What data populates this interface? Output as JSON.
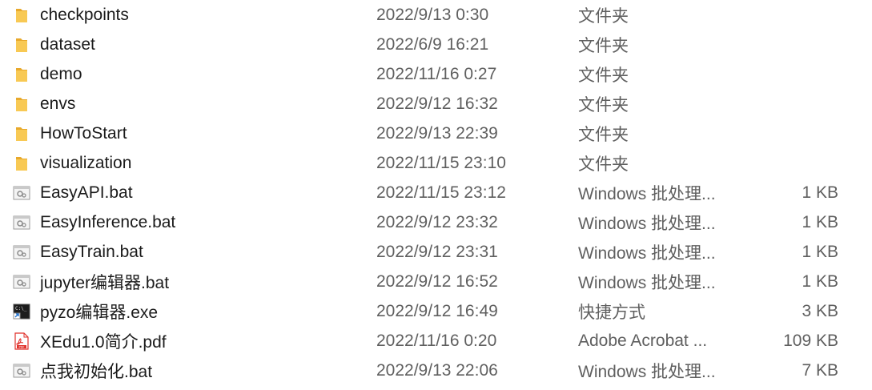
{
  "files": [
    {
      "name": "checkpoints",
      "date": "2022/9/13 0:30",
      "type": "文件夹",
      "size": "",
      "icon": "folder-icon"
    },
    {
      "name": "dataset",
      "date": "2022/6/9 16:21",
      "type": "文件夹",
      "size": "",
      "icon": "folder-icon"
    },
    {
      "name": "demo",
      "date": "2022/11/16 0:27",
      "type": "文件夹",
      "size": "",
      "icon": "folder-icon"
    },
    {
      "name": "envs",
      "date": "2022/9/12 16:32",
      "type": "文件夹",
      "size": "",
      "icon": "folder-icon"
    },
    {
      "name": "HowToStart",
      "date": "2022/9/13 22:39",
      "type": "文件夹",
      "size": "",
      "icon": "folder-icon"
    },
    {
      "name": "visualization",
      "date": "2022/11/15 23:10",
      "type": "文件夹",
      "size": "",
      "icon": "folder-icon"
    },
    {
      "name": "EasyAPI.bat",
      "date": "2022/11/15 23:12",
      "type": "Windows 批处理...",
      "size": "1 KB",
      "icon": "batch-file-icon"
    },
    {
      "name": "EasyInference.bat",
      "date": "2022/9/12 23:32",
      "type": "Windows 批处理...",
      "size": "1 KB",
      "icon": "batch-file-icon"
    },
    {
      "name": "EasyTrain.bat",
      "date": "2022/9/12 23:31",
      "type": "Windows 批处理...",
      "size": "1 KB",
      "icon": "batch-file-icon"
    },
    {
      "name": "jupyter编辑器.bat",
      "date": "2022/9/12 16:52",
      "type": "Windows 批处理...",
      "size": "1 KB",
      "icon": "batch-file-icon"
    },
    {
      "name": "pyzo编辑器.exe",
      "date": "2022/9/12 16:49",
      "type": "快捷方式",
      "size": "3 KB",
      "icon": "shortcut-console-icon"
    },
    {
      "name": "XEdu1.0简介.pdf",
      "date": "2022/11/16 0:20",
      "type": "Adobe Acrobat ...",
      "size": "109 KB",
      "icon": "pdf-file-icon"
    },
    {
      "name": "点我初始化.bat",
      "date": "2022/9/13 22:06",
      "type": "Windows 批处理...",
      "size": "7 KB",
      "icon": "batch-file-icon"
    }
  ],
  "colors": {
    "folder": "#f8c954",
    "folder_dark": "#e8a92c",
    "pdf": "#e0312b",
    "text": "#1b1b1b",
    "muted": "#5f5f5f"
  }
}
